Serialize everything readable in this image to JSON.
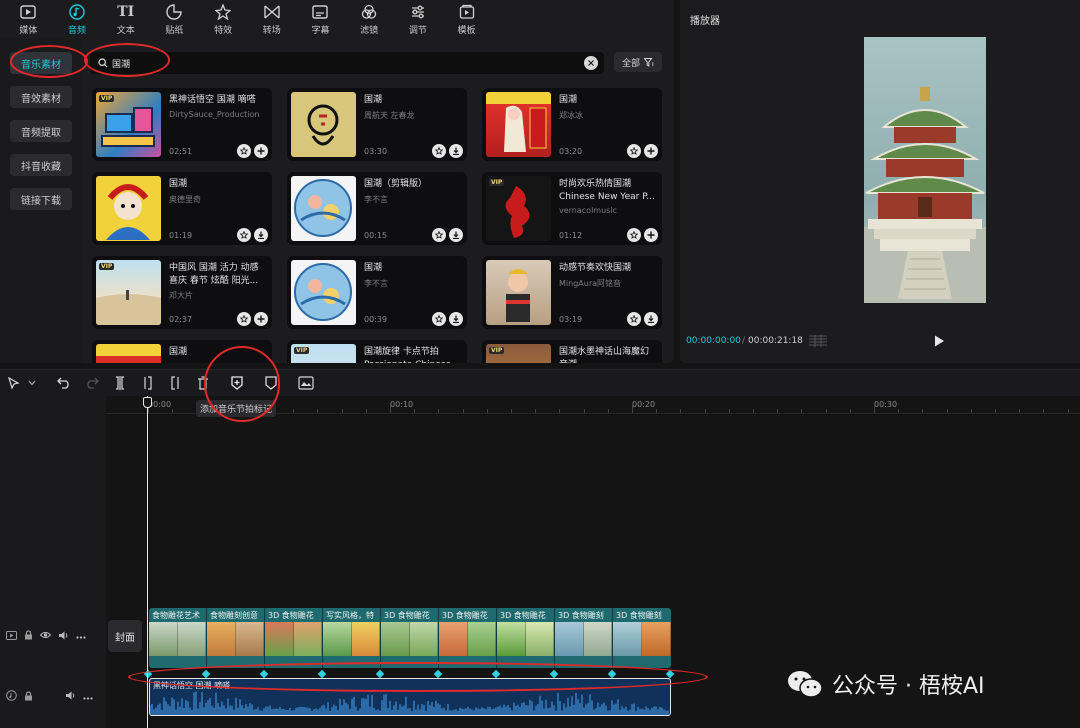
{
  "media_tabs": [
    {
      "label": "媒体",
      "icon": "media-icon"
    },
    {
      "label": "音频",
      "icon": "audio-icon",
      "active": true
    },
    {
      "label": "文本",
      "icon": "text-icon"
    },
    {
      "label": "贴纸",
      "icon": "sticker-icon"
    },
    {
      "label": "特效",
      "icon": "effects-icon"
    },
    {
      "label": "转场",
      "icon": "transition-icon"
    },
    {
      "label": "字幕",
      "icon": "subtitle-icon"
    },
    {
      "label": "滤镜",
      "icon": "filter-icon"
    },
    {
      "label": "调节",
      "icon": "adjust-icon"
    },
    {
      "label": "模板",
      "icon": "template-icon"
    }
  ],
  "text_tab_glyph": "TI",
  "side_nav": [
    {
      "label": "音乐素材",
      "active": true
    },
    {
      "label": "音效素材"
    },
    {
      "label": "音频提取"
    },
    {
      "label": "抖音收藏"
    },
    {
      "label": "链接下载"
    }
  ],
  "search": {
    "value": "国潮"
  },
  "filter": {
    "label": "全部"
  },
  "vip_badge": "VIP",
  "tracks": [
    {
      "title": "黑神话悟空 国潮 嘀嗒",
      "artist": "DirtySauce_Production",
      "duration": "02:51",
      "vip": true,
      "action": "add"
    },
    {
      "title": "国潮",
      "artist": "周航天 左春龙",
      "duration": "03:30",
      "vip": false,
      "action": "download"
    },
    {
      "title": "国潮",
      "artist": "郑冰冰",
      "duration": "03:20",
      "vip": false,
      "action": "add"
    },
    {
      "title": "国潮",
      "artist": "奥德里奇",
      "duration": "01:19",
      "vip": false,
      "action": "download"
    },
    {
      "title": "国潮（剪辑版）",
      "artist": "李不言",
      "duration": "00:15",
      "vip": false,
      "action": "download"
    },
    {
      "title": "时尚欢乐热情国潮\nChinese New Year P...",
      "artist": "vernacolmusic",
      "duration": "01:12",
      "vip": true,
      "action": "add"
    },
    {
      "title": "中国风 国潮 活力 动感\n喜庆 春节 炫酷 阳光...",
      "artist": "邓大片",
      "duration": "02:37",
      "vip": true,
      "action": "add"
    },
    {
      "title": "国潮",
      "artist": "李不言",
      "duration": "00:39",
      "vip": false,
      "action": "download"
    },
    {
      "title": "动感节奏欢快国潮",
      "artist": "MingAura阿铭音",
      "duration": "03:19",
      "vip": false,
      "action": "download"
    },
    {
      "title": "国潮",
      "artist": "",
      "duration": "",
      "vip": false,
      "action": "add"
    },
    {
      "title": "国潮旋律 卡点节拍\nPassionate Chinese",
      "artist": "",
      "duration": "",
      "vip": true,
      "action": "add"
    },
    {
      "title": "国潮水墨神话山海魔幻\n音潮",
      "artist": "",
      "duration": "",
      "vip": true,
      "action": "add"
    }
  ],
  "player": {
    "title": "播放器",
    "current_time": "00:00:00:00",
    "separator": "/",
    "total_time": "00:00:21:18"
  },
  "toolbar": {
    "tooltip": "添加音乐节拍标记"
  },
  "ruler_labels": [
    "00:00",
    "00:10",
    "00:20",
    "00:30"
  ],
  "cover_label": "封面",
  "video_clips": [
    {
      "label": "食物雕花艺术"
    },
    {
      "label": "食物雕刻创意"
    },
    {
      "label": "3D 食物雕花"
    },
    {
      "label": "写实风格，特"
    },
    {
      "label": "3D 食物雕花"
    },
    {
      "label": "3D 食物雕花"
    },
    {
      "label": "3D 食物雕花"
    },
    {
      "label": "3D 食物雕刻"
    },
    {
      "label": "3D 食物雕刻"
    }
  ],
  "audio_clip": {
    "label": "黑神话悟空 国潮 嘀嗒"
  },
  "watermark": {
    "text": "公众号 · 梧桉AI"
  },
  "colors": {
    "accent": "#1fcbd8",
    "annotation": "#e02a2a",
    "video_track": "#1e6a6e",
    "audio_track": "#10325a"
  }
}
